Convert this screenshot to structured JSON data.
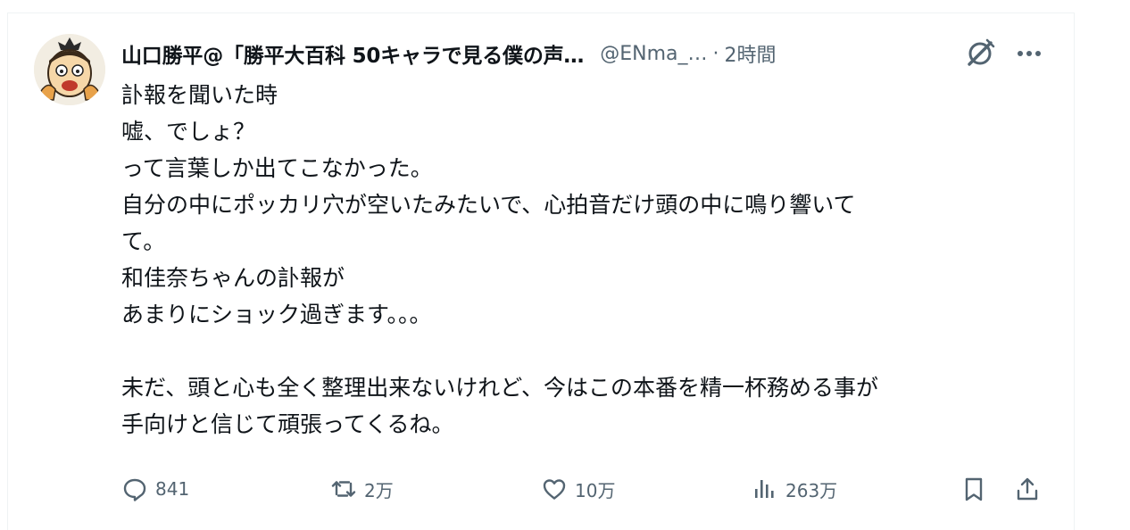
{
  "post": {
    "author_name": "山口勝平@「勝平大百科 50キャラで見る僕の声…",
    "handle": "@ENma_…",
    "separator": "·",
    "time": "2時間",
    "lines": [
      "訃報を聞いた時",
      "嘘、でしょ？",
      "って言葉しか出てこなかった。",
      "自分の中にポッカリ穴が空いたみたいで、心拍音だけ頭の中に鳴り響いて",
      "て。",
      "和佳奈ちゃんの訃報が",
      "あまりにショック過ぎます。。。",
      "",
      "未だ、頭と心も全く整理出来ないけれど、今はこの本番を精一杯務める事が",
      "手向けと信じて頑張ってくるね。"
    ]
  },
  "actions": {
    "replies": "841",
    "reposts": "2万",
    "likes": "10万",
    "views": "263万"
  },
  "icons": {
    "header": [
      "grok-icon",
      "more-icon"
    ],
    "actions": [
      "reply-icon",
      "repost-icon",
      "like-icon",
      "views-icon",
      "bookmark-icon",
      "share-icon"
    ]
  },
  "colors": {
    "text": "#0f1419",
    "secondary": "#536471"
  }
}
